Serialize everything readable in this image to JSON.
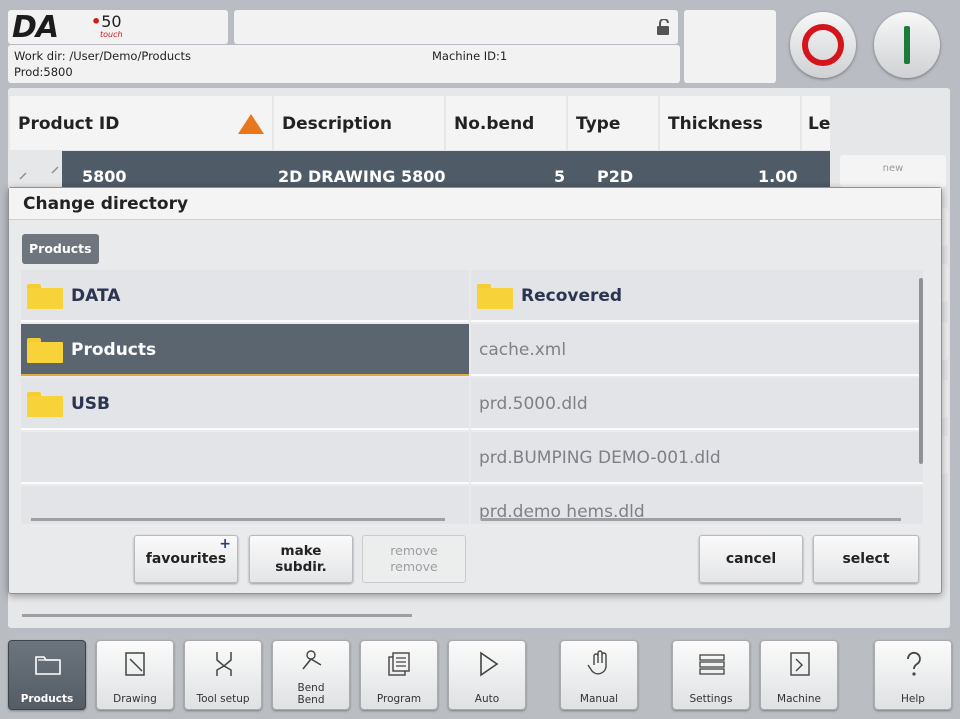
{
  "header": {
    "logo": "DA",
    "model": "50",
    "model_sub": "touch",
    "work_dir": "Work dir: /User/Demo/Products",
    "prod": "Prod:5800",
    "machine_id": "Machine ID:1"
  },
  "table": {
    "columns": [
      "Product ID",
      "Description",
      "No.bend",
      "Type",
      "Thickness",
      "Le"
    ],
    "row": {
      "product_id": "5800",
      "description": "2D DRAWING 5800",
      "no_bend": "5",
      "type": "P2D",
      "thickness": "1.00"
    },
    "side_button": "new"
  },
  "dialog": {
    "title": "Change directory",
    "breadcrumb": "Products",
    "folders": [
      {
        "name": "DATA",
        "selected": false
      },
      {
        "name": "Products",
        "selected": true
      },
      {
        "name": "USB",
        "selected": false
      }
    ],
    "files": [
      {
        "name": "Recovered",
        "is_folder": true
      },
      {
        "name": "cache.xml",
        "is_folder": false
      },
      {
        "name": "prd.5000.dld",
        "is_folder": false
      },
      {
        "name": "prd.BUMPING DEMO-001.dld",
        "is_folder": false
      },
      {
        "name": "prd.demo hems.dld",
        "is_folder": false
      }
    ],
    "buttons": {
      "favourites": "favourites",
      "favourites_badge": "+",
      "make_line1": "make",
      "make_line2": "subdir.",
      "remove_line1": "remove",
      "remove_line2": "remove",
      "cancel": "cancel",
      "select": "select"
    }
  },
  "nav": [
    {
      "label": "Products",
      "icon": "folder-icon",
      "active": true
    },
    {
      "label": "Drawing",
      "icon": "pencil-icon",
      "active": false
    },
    {
      "label": "Tool setup",
      "icon": "tool-icon",
      "active": false
    },
    {
      "label_line1": "Bend",
      "label_line2": "Bend",
      "icon": "bend-icon",
      "active": false
    },
    {
      "label": "Program",
      "icon": "program-icon",
      "active": false
    },
    {
      "label": "Auto",
      "icon": "play-icon",
      "active": false
    },
    {
      "label": "Manual",
      "icon": "hand-icon",
      "active": false
    },
    {
      "label": "Settings",
      "icon": "settings-icon",
      "active": false
    },
    {
      "label": "Machine",
      "icon": "machine-icon",
      "active": false
    },
    {
      "label": "Help",
      "icon": "help-icon",
      "active": false
    }
  ],
  "colors": {
    "selected_row": "#5a6570",
    "accent_orange": "#e8761c",
    "stop_red": "#d4151b",
    "start_green": "#1c7a3a",
    "folder_yellow": "#f7d339"
  }
}
